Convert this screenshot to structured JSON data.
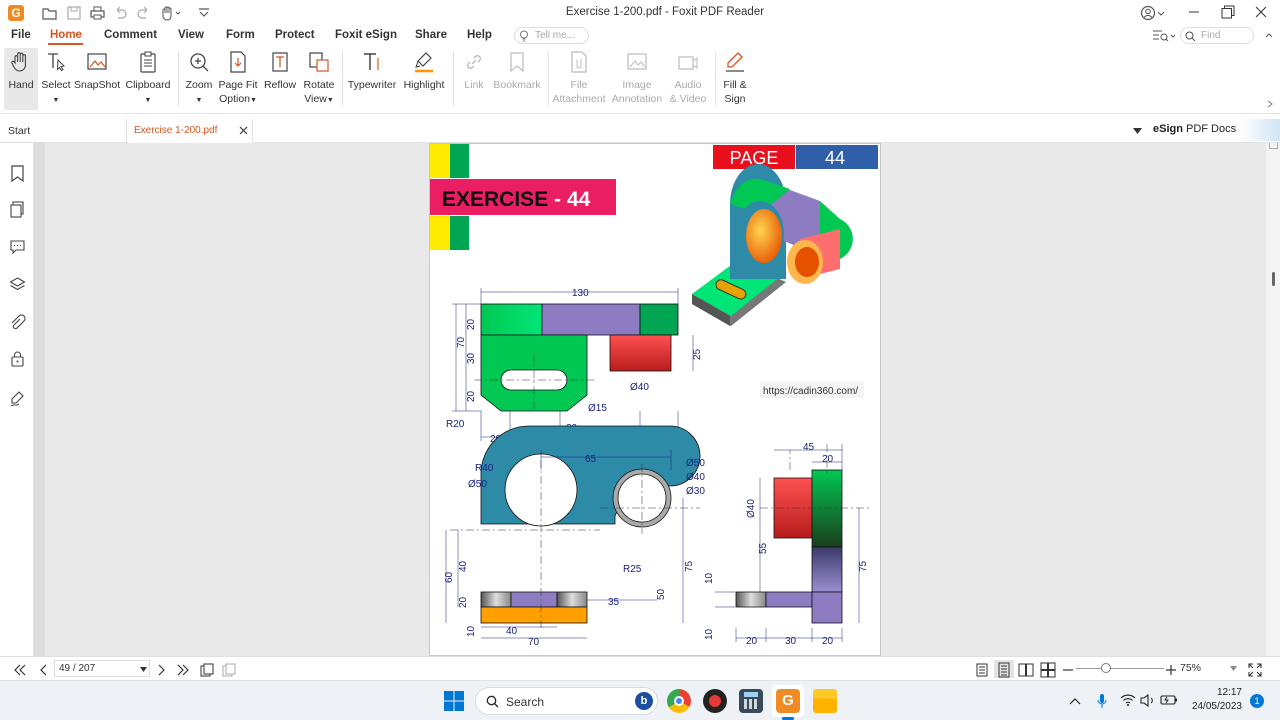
{
  "window": {
    "title": "Exercise 1-200.pdf - Foxit PDF Reader"
  },
  "menu": {
    "items": [
      "File",
      "Home",
      "Comment",
      "View",
      "Form",
      "Protect",
      "Foxit eSign",
      "Share",
      "Help"
    ],
    "active": "Home",
    "tell_me_placeholder": "Tell me...",
    "find_placeholder": "Find"
  },
  "ribbon": {
    "hand": "Hand",
    "select": "Select",
    "snapshot": "SnapShot",
    "clipboard": "Clipboard",
    "zoom": "Zoom",
    "page_fit_1": "Page Fit",
    "page_fit_2": "Option",
    "reflow": "Reflow",
    "rotate_1": "Rotate",
    "rotate_2": "View",
    "typewriter": "Typewriter",
    "highlight": "Highlight",
    "link": "Link",
    "bookmark": "Bookmark",
    "file_att_1": "File",
    "file_att_2": "Attachment",
    "image_ann_1": "Image",
    "image_ann_2": "Annotation",
    "audio_1": "Audio",
    "audio_2": "& Video",
    "fill_1": "Fill &",
    "fill_2": "Sign"
  },
  "tabs": {
    "start": "Start",
    "document": "Exercise 1-200.pdf",
    "esign_bold": "eSign",
    "esign_rest": "PDF Docs"
  },
  "page": {
    "page_label": "PAGE",
    "page_number": "44",
    "exercise_label": "EXERCISE",
    "exercise_dash": "-",
    "exercise_number": "44",
    "watermark": "https://cadin360.com/",
    "dims": {
      "d130": "130",
      "d20a": "20",
      "d70": "70",
      "d30a": "30",
      "d20b": "20",
      "d25a": "25",
      "d40a": "Ø40",
      "d15": "Ø15",
      "r20": "R20",
      "b20": "20",
      "b30": "30",
      "b20b": "20",
      "b55": "55",
      "b25": "25",
      "r40": "R40",
      "d50": "Ø50",
      "d65": "65",
      "c50": "Ø50",
      "c40": "Ø40",
      "c30": "Ø30",
      "r25": "R25",
      "v40": "40",
      "v60": "60",
      "v20": "20",
      "v10": "10",
      "v50": "50",
      "v75": "75",
      "h35": "35",
      "h40": "40",
      "h70": "70",
      "s45": "45",
      "s20": "20",
      "s40": "Ø40",
      "s55": "55",
      "s75": "75",
      "s10a": "10",
      "s10b": "10",
      "sb20a": "20",
      "sb30": "30",
      "sb20b": "20"
    }
  },
  "status": {
    "page_input": "49 / 207",
    "zoom": "75%"
  },
  "taskbar": {
    "search": "Search",
    "time": "12:17",
    "date": "24/05/2023",
    "notif": "1"
  },
  "colors": {
    "accent": "#d9541e",
    "exercise_bg": "#e91e63",
    "page_red": "#e8101c",
    "page_blue": "#2e5fa8",
    "green": "#00c853",
    "purple": "#8e7cc3",
    "teal": "#2e8ba8",
    "orange": "#ffa000",
    "dim_text": "#1a237e"
  }
}
